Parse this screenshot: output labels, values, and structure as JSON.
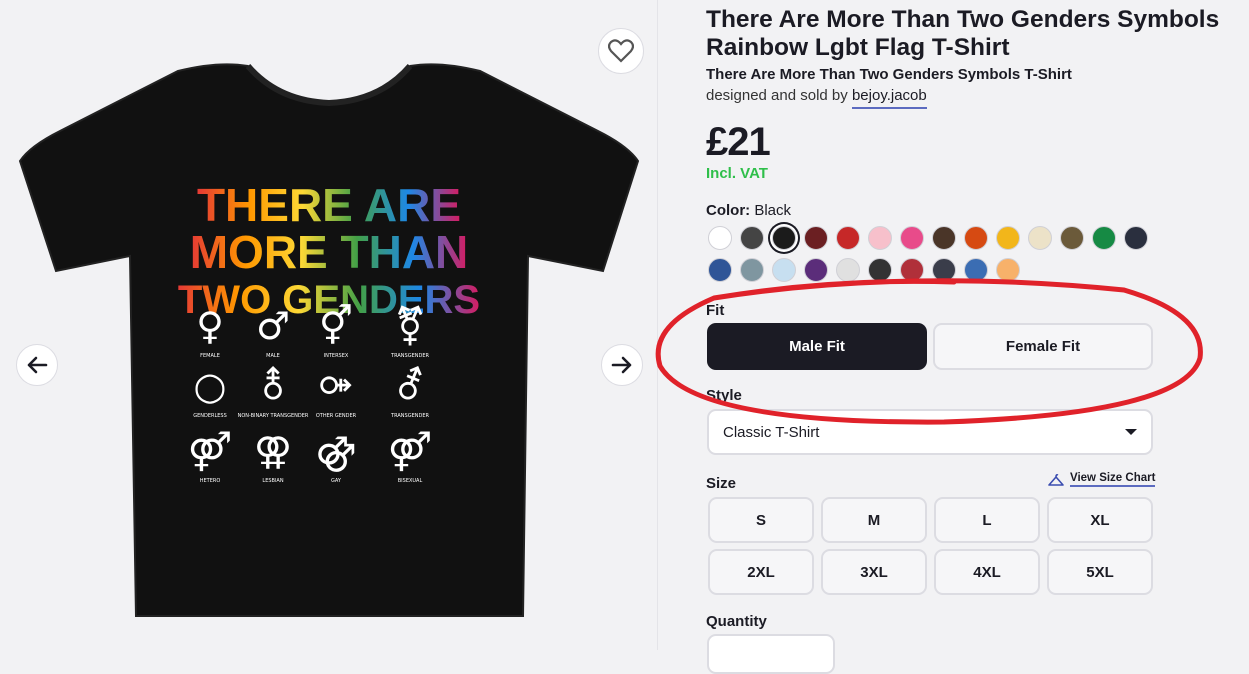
{
  "product": {
    "title": "There Are More Than Two Genders Symbols Rainbow Lgbt Flag T-Shirt",
    "subtitle": "There Are More Than Two Genders Symbols T-Shirt",
    "byline_prefix": "designed and sold by",
    "designer": "bejoy.jacob",
    "price": "£21",
    "vat": "Incl. VAT"
  },
  "print": {
    "lines": [
      "THERE ARE",
      "MORE THAN",
      "TWO GENDERS"
    ],
    "symbols": [
      {
        "label": "FEMALE",
        "glyph": "♀"
      },
      {
        "label": "MALE",
        "glyph": "♂"
      },
      {
        "label": "INTERSEX",
        "glyph": "⚥"
      },
      {
        "label": "TRANSGENDER",
        "glyph": "⚧"
      },
      {
        "label": "GENDERLESS",
        "glyph": "○"
      },
      {
        "label": "NON-BINARY TRANSGENDER",
        "glyph": "⚨"
      },
      {
        "label": "OTHER GENDER",
        "glyph": "⚩"
      },
      {
        "label": "TRANSGENDER",
        "glyph": "⚦"
      },
      {
        "label": "HETERO",
        "glyph": "⚤"
      },
      {
        "label": "LESBIAN",
        "glyph": "⚢"
      },
      {
        "label": "GAY",
        "glyph": "⚣"
      },
      {
        "label": "BISEXUAL",
        "glyph": "⚤"
      }
    ]
  },
  "color": {
    "label": "Color:",
    "selected": "Black",
    "swatches": [
      "#ffffff",
      "#444444",
      "#1b1b1b",
      "#6b1f22",
      "#c62828",
      "#f7c0cb",
      "#e84b8a",
      "#4a3528",
      "#d64a12",
      "#f2b61a",
      "#ece2c8",
      "#6b5a3a",
      "#168a44",
      "#2a2f3e",
      "#2f5597",
      "#7f96a0",
      "#c7dff0",
      "#5b2d7a",
      "#e0e0e0",
      "#333333",
      "#b0303a",
      "#3a3d4a",
      "#3b6db3",
      "#f7b16a"
    ]
  },
  "fit": {
    "label": "Fit",
    "options": [
      "Male Fit",
      "Female Fit"
    ],
    "selected": "Male Fit"
  },
  "style": {
    "label": "Style",
    "value": "Classic T-Shirt"
  },
  "size": {
    "label": "Size",
    "chart_link": "View Size Chart",
    "options": [
      "S",
      "M",
      "L",
      "XL",
      "2XL",
      "3XL",
      "4XL",
      "5XL"
    ]
  },
  "quantity": {
    "label": "Quantity"
  },
  "icons": {
    "favorite": "heart-icon",
    "prev": "arrow-left-icon",
    "next": "arrow-right-icon",
    "size_chart": "hanger-icon"
  }
}
